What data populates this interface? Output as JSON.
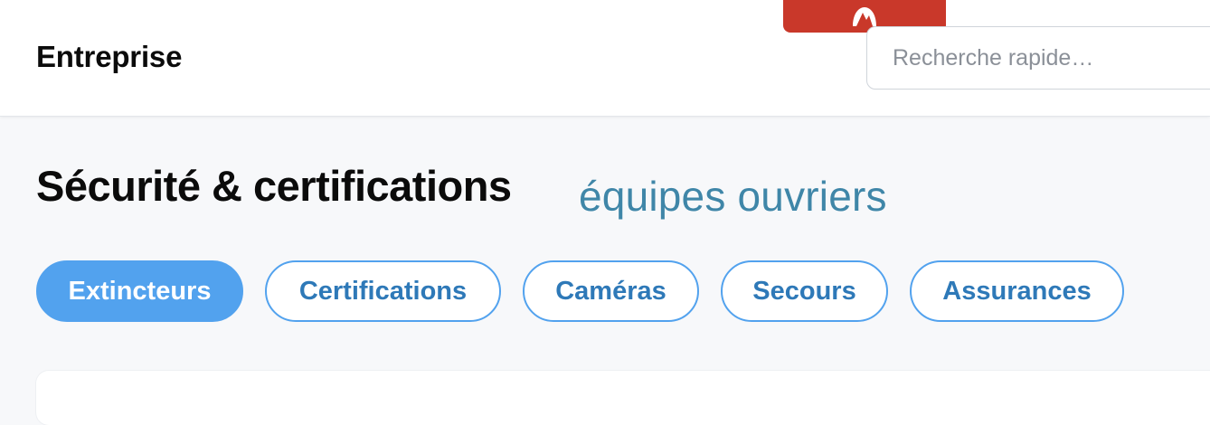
{
  "header": {
    "brand": "Entreprise",
    "search": {
      "placeholder": "Recherche rapide…",
      "value": ""
    },
    "vpn_tab": {
      "icon": "mountain-logo-icon",
      "color": "#c9382a"
    }
  },
  "main": {
    "title": "Sécurité & certifications",
    "subtitle": "équipes ouvriers",
    "tabs": [
      {
        "label": "Extincteurs",
        "active": true
      },
      {
        "label": "Certifications",
        "active": false
      },
      {
        "label": "Caméras",
        "active": false
      },
      {
        "label": "Secours",
        "active": false
      },
      {
        "label": "Assurances",
        "active": false
      }
    ]
  },
  "colors": {
    "accent": "#52a2ee",
    "tab_text": "#2e79b8",
    "subtitle": "#3f86a8",
    "background": "#f7f8fa"
  }
}
